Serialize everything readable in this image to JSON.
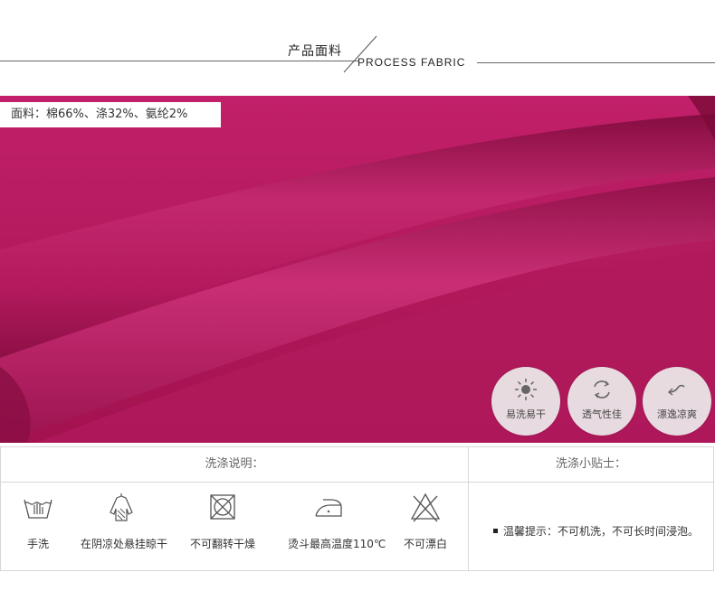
{
  "header": {
    "title_cn": "产品面料",
    "title_en": "PROCESS FABRIC"
  },
  "fabric": {
    "composition": "面料：棉66%、涤32%、氨纶2%",
    "color": "#b0185a"
  },
  "features": [
    {
      "label": "易洗易干",
      "icon": "sun-icon"
    },
    {
      "label": "透气性佳",
      "icon": "breathable-icon"
    },
    {
      "label": "漂逸凉爽",
      "icon": "wind-icon"
    }
  ],
  "care": {
    "heading": "洗涤说明：",
    "items": [
      {
        "label": "手洗",
        "icon": "hand-wash-icon"
      },
      {
        "label": "在阴凉处悬挂晾干",
        "icon": "hang-dry-icon"
      },
      {
        "label": "不可翻转干燥",
        "icon": "no-tumble-dry-icon"
      },
      {
        "label": "烫斗最高温度110℃",
        "icon": "iron-icon"
      },
      {
        "label": "不可漂白",
        "icon": "no-bleach-icon"
      }
    ]
  },
  "tips": {
    "heading": "洗涤小贴士：",
    "text": "温馨提示：不可机洗，不可长时间浸泡。"
  }
}
